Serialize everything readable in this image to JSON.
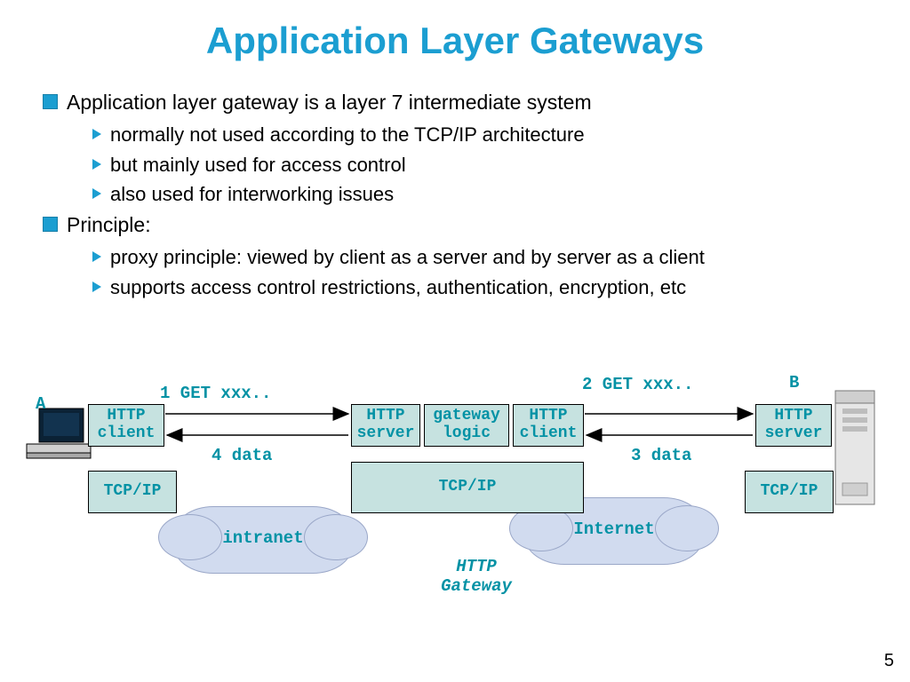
{
  "title": "Application Layer Gateways",
  "page_number": "5",
  "bullets": {
    "item1": "Application layer gateway is a layer 7 intermediate system",
    "item1_sub1": "normally not used according to the TCP/IP architecture",
    "item1_sub2": "but mainly used for access control",
    "item1_sub3": "also used for interworking issues",
    "item2": "Principle:",
    "item2_sub1": "proxy principle: viewed by client as a server and by server as a client",
    "item2_sub2": "supports access control restrictions, authentication, encryption, etc"
  },
  "diagram": {
    "endpoints": {
      "a": "A",
      "b": "B"
    },
    "clouds": {
      "intranet": "intranet",
      "internet": "Internet"
    },
    "gateway_label_l1": "HTTP",
    "gateway_label_l2": "Gateway",
    "boxes": {
      "client_left_l1": "HTTP",
      "client_left_l2": "client",
      "gw_server_l1": "HTTP",
      "gw_server_l2": "server",
      "gw_logic_l1": "gateway",
      "gw_logic_l2": "logic",
      "gw_client_l1": "HTTP",
      "gw_client_l2": "client",
      "server_right_l1": "HTTP",
      "server_right_l2": "server",
      "tcpip_left": "TCP/IP",
      "tcpip_mid": "TCP/IP",
      "tcpip_right": "TCP/IP"
    },
    "arrows": {
      "get1": "1 GET xxx..",
      "get2": "2 GET xxx..",
      "data3": "3 data",
      "data4": "4 data"
    }
  }
}
